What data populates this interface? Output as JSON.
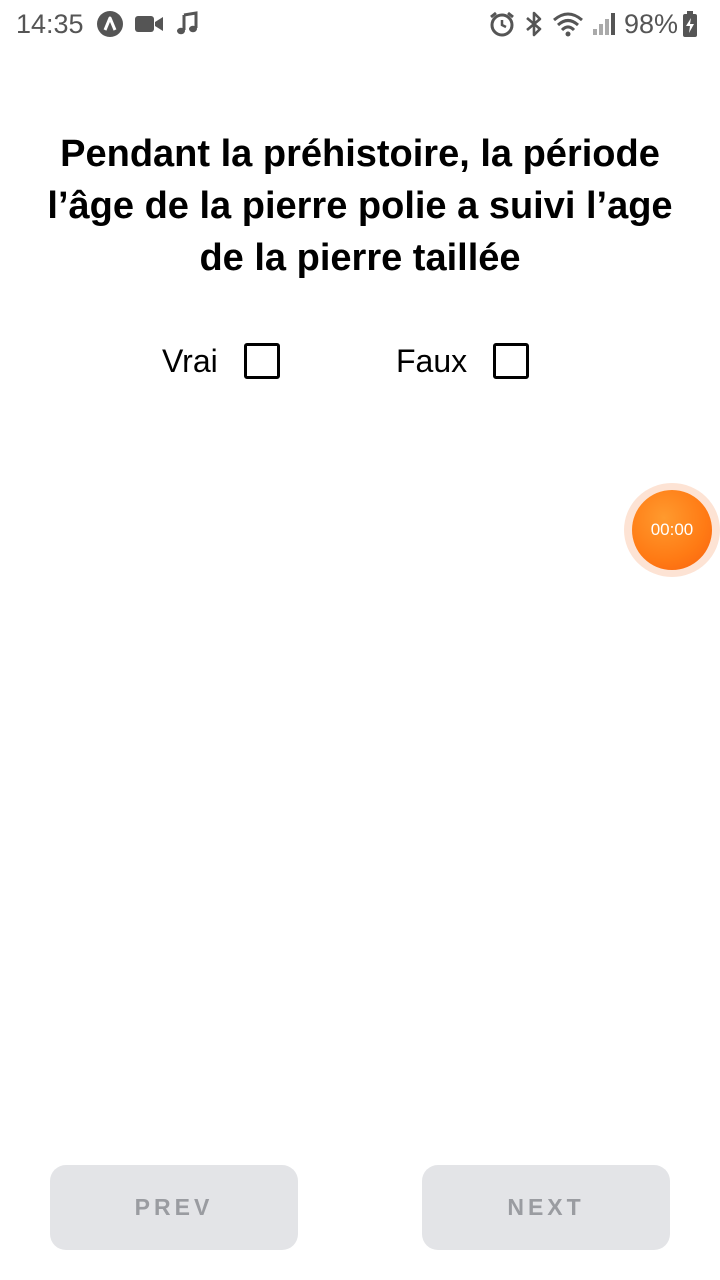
{
  "status_bar": {
    "time": "14:35",
    "battery": "98%",
    "left_icons": [
      "android-studio-icon",
      "video-camera-icon",
      "music-note-icon"
    ],
    "right_icons": [
      "alarm-icon",
      "bluetooth-icon",
      "wifi-icon",
      "cell-signal-icon",
      "battery-charging-icon"
    ]
  },
  "question": {
    "text": "Pendant la préhistoire, la période l’âge de la pierre polie a suivi l’age de la pierre taillée"
  },
  "options": [
    {
      "label": "Vrai",
      "checked": false
    },
    {
      "label": "Faux",
      "checked": false
    }
  ],
  "timer": {
    "value": "00:00",
    "color": "#ff7a14"
  },
  "navigation": {
    "prev_label": "PREV",
    "next_label": "NEXT"
  },
  "colors": {
    "button_bg": "#e3e4e7",
    "button_text": "#9a9ca1",
    "accent": "#ff7a14"
  }
}
